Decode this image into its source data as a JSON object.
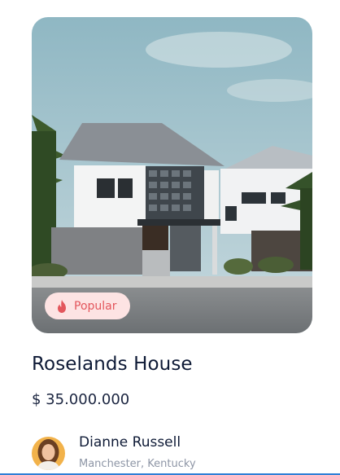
{
  "listing": {
    "badge": {
      "label": "Popular",
      "icon": "fire-icon"
    },
    "title": "Roselands House",
    "price": "$ 35.000.000",
    "agent": {
      "name": "Dianne Russell",
      "location": "Manchester, Kentucky"
    }
  },
  "colors": {
    "badge_bg": "#fde3e3",
    "badge_text": "#e3565c",
    "title": "#0e1a36",
    "subtle_text": "#8e96a6"
  }
}
